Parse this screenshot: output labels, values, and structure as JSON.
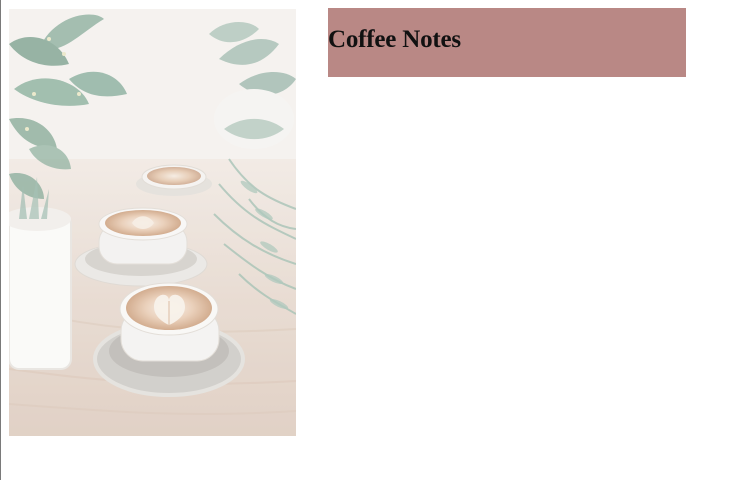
{
  "header": {
    "title": "Coffee Notes"
  },
  "hero_image": {
    "alt": "",
    "icon": "coffee-photo"
  },
  "colors": {
    "title_card_bg": "#b98885",
    "title_text": "#111111",
    "page_bg": "#ffffff"
  }
}
